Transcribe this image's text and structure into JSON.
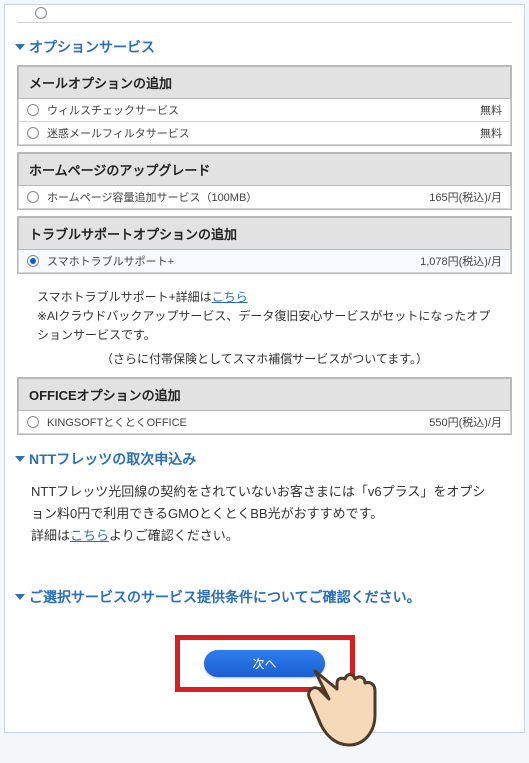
{
  "section1": {
    "title": "オプションサービス",
    "groups": [
      {
        "header": "メールオプションの追加",
        "rows": [
          {
            "label": "ウィルスチェックサービス",
            "price": "無料",
            "checked": false
          },
          {
            "label": "迷惑メールフィルタサービス",
            "price": "無料",
            "checked": false
          }
        ]
      },
      {
        "header": "ホームページのアップグレード",
        "rows": [
          {
            "label": "ホームページ容量追加サービス（100MB）",
            "price": "165円(税込)/月",
            "checked": false
          }
        ]
      },
      {
        "header": "トラブルサポートオプションの追加",
        "rows": [
          {
            "label": "スマホトラブルサポート+",
            "price": "1,078円(税込)/月",
            "checked": true
          }
        ]
      }
    ],
    "detail_prefix": "スマホトラブルサポート+詳細は",
    "detail_link": "こちら",
    "note": "※AIクラウドバックアップサービス、データ復旧安心サービスがセットになったオプションサービスです。",
    "paren": "（さらに付帯保険としてスマホ補償サービスがついてます。）",
    "office": {
      "header": "OFFICEオプションの追加",
      "rows": [
        {
          "label": "KINGSOFTとくとくOFFICE",
          "price": "550円(税込)/月",
          "checked": false
        }
      ]
    }
  },
  "section2": {
    "title": "NTTフレッツの取次申込み",
    "body1": "NTTフレッツ光回線の契約をされていないお客さまには「v6プラス」をオプション料0円で利用できるGMOとくとくBB光がおすすめです。",
    "body2_prefix": "詳細は",
    "body2_link": "こちら",
    "body2_suffix": "よりご確認ください。"
  },
  "section3": {
    "title": "ご選択サービスのサービス提供条件についてご確認ください。"
  },
  "next_label": "次へ"
}
